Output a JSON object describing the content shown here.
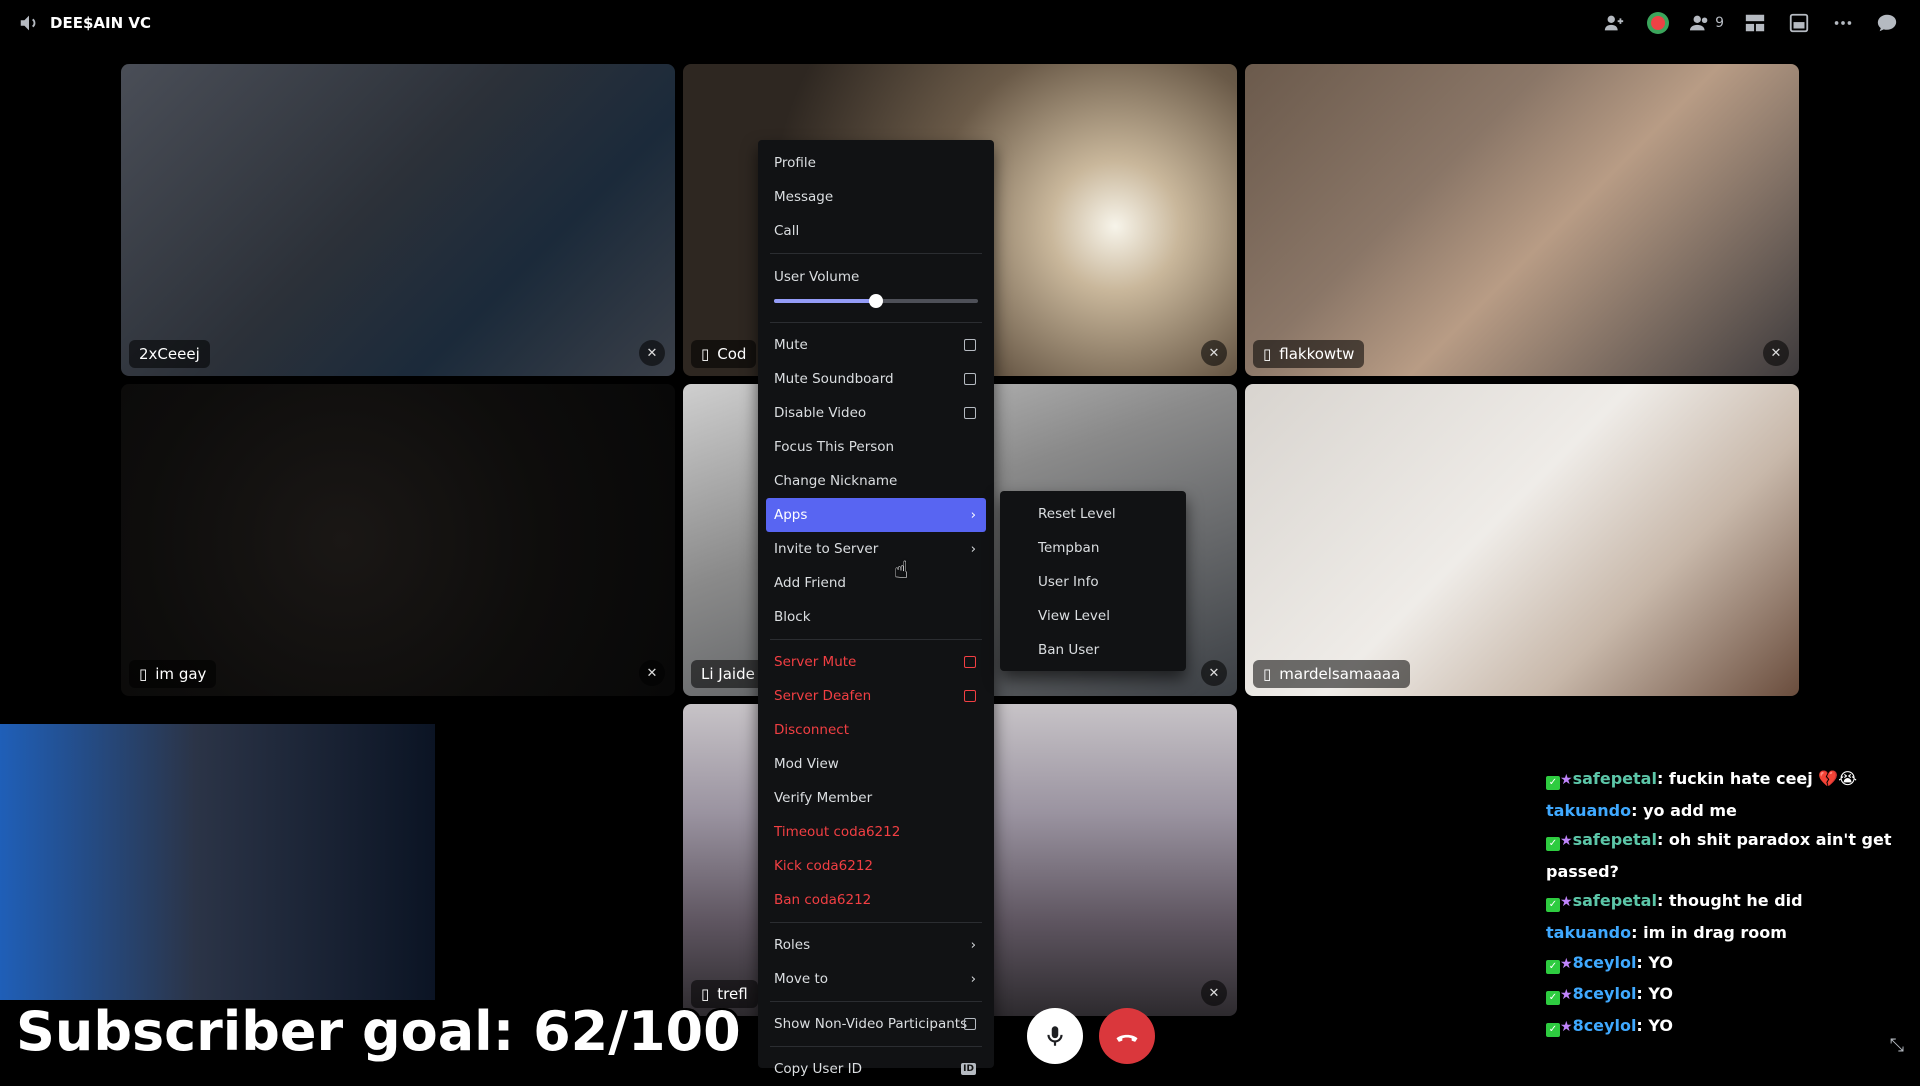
{
  "topbar": {
    "channel_name": "DEE$AIN VC",
    "participant_count": "9"
  },
  "tiles": [
    {
      "label": "2xCeeej",
      "mobile": false,
      "muted": true
    },
    {
      "label": "Cod",
      "mobile": true,
      "muted": true
    },
    {
      "label": "flakkowtw",
      "mobile": true,
      "muted": true
    },
    {
      "label": "im gay",
      "mobile": true,
      "muted": true
    },
    {
      "label": "Li Jaide",
      "mobile": false,
      "muted": true
    },
    {
      "label": "mardelsamaaaa",
      "mobile": true,
      "muted": false
    },
    {
      "label": "trefl",
      "mobile": true,
      "muted": true
    }
  ],
  "context_menu": {
    "profile": "Profile",
    "message": "Message",
    "call": "Call",
    "user_volume": "User Volume",
    "user_volume_level": 0.5,
    "mute": "Mute",
    "mute_soundboard": "Mute Soundboard",
    "disable_video": "Disable Video",
    "focus_person": "Focus This Person",
    "change_nickname": "Change Nickname",
    "apps": "Apps",
    "invite_to_server": "Invite to Server",
    "add_friend": "Add Friend",
    "block": "Block",
    "server_mute": "Server Mute",
    "server_deafen": "Server Deafen",
    "disconnect": "Disconnect",
    "mod_view": "Mod View",
    "verify_member": "Verify Member",
    "timeout": "Timeout coda6212",
    "kick": "Kick coda6212",
    "ban": "Ban coda6212",
    "roles": "Roles",
    "move_to": "Move to",
    "show_non_video": "Show Non-Video Participants",
    "copy_user_id": "Copy User ID",
    "id_badge": "ID"
  },
  "apps_submenu": {
    "reset_level": "Reset Level",
    "tempban": "Tempban",
    "user_info": "User Info",
    "view_level": "View Level",
    "ban_user": "Ban User"
  },
  "chat": [
    {
      "user": "safepetal",
      "text": "fuckin hate ceej 💔😭",
      "badges": true,
      "color": "#5cc6a8"
    },
    {
      "user": "takuando",
      "text": "yo add me",
      "badges": false,
      "color": "#3fa9ff"
    },
    {
      "user": "safepetal",
      "text": "oh shit paradox ain't get passed?",
      "badges": true,
      "color": "#5cc6a8"
    },
    {
      "user": "safepetal",
      "text": "thought he did",
      "badges": true,
      "color": "#5cc6a8"
    },
    {
      "user": "takuando",
      "text": "im in drag room",
      "badges": false,
      "color": "#3fa9ff"
    },
    {
      "user": "8ceylol",
      "text": "YO",
      "badges": true,
      "color": "#3fa9ff"
    },
    {
      "user": "8ceylol",
      "text": "YO",
      "badges": true,
      "color": "#3fa9ff"
    },
    {
      "user": "8ceylol",
      "text": "YO",
      "badges": true,
      "color": "#3fa9ff"
    }
  ],
  "overlay": {
    "subscriber_goal": "Subscriber goal: 62/100"
  },
  "colors": {
    "accent": "#5865f2",
    "danger": "#f23f43",
    "menu_bg": "#111214"
  }
}
